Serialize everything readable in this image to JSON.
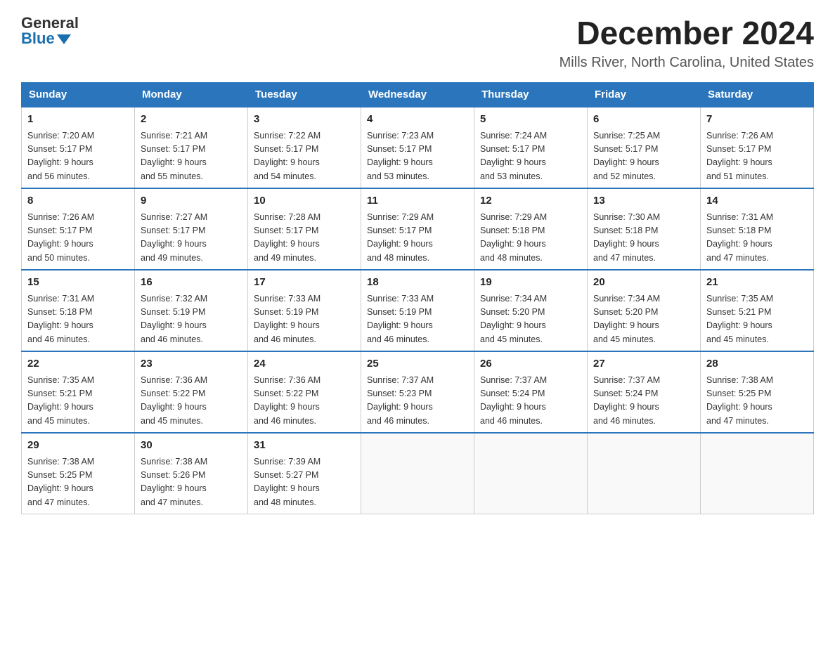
{
  "header": {
    "logo_general": "General",
    "logo_blue": "Blue",
    "title": "December 2024",
    "subtitle": "Mills River, North Carolina, United States"
  },
  "calendar": {
    "days_of_week": [
      "Sunday",
      "Monday",
      "Tuesday",
      "Wednesday",
      "Thursday",
      "Friday",
      "Saturday"
    ],
    "weeks": [
      [
        {
          "day": "1",
          "info": "Sunrise: 7:20 AM\nSunset: 5:17 PM\nDaylight: 9 hours\nand 56 minutes."
        },
        {
          "day": "2",
          "info": "Sunrise: 7:21 AM\nSunset: 5:17 PM\nDaylight: 9 hours\nand 55 minutes."
        },
        {
          "day": "3",
          "info": "Sunrise: 7:22 AM\nSunset: 5:17 PM\nDaylight: 9 hours\nand 54 minutes."
        },
        {
          "day": "4",
          "info": "Sunrise: 7:23 AM\nSunset: 5:17 PM\nDaylight: 9 hours\nand 53 minutes."
        },
        {
          "day": "5",
          "info": "Sunrise: 7:24 AM\nSunset: 5:17 PM\nDaylight: 9 hours\nand 53 minutes."
        },
        {
          "day": "6",
          "info": "Sunrise: 7:25 AM\nSunset: 5:17 PM\nDaylight: 9 hours\nand 52 minutes."
        },
        {
          "day": "7",
          "info": "Sunrise: 7:26 AM\nSunset: 5:17 PM\nDaylight: 9 hours\nand 51 minutes."
        }
      ],
      [
        {
          "day": "8",
          "info": "Sunrise: 7:26 AM\nSunset: 5:17 PM\nDaylight: 9 hours\nand 50 minutes."
        },
        {
          "day": "9",
          "info": "Sunrise: 7:27 AM\nSunset: 5:17 PM\nDaylight: 9 hours\nand 49 minutes."
        },
        {
          "day": "10",
          "info": "Sunrise: 7:28 AM\nSunset: 5:17 PM\nDaylight: 9 hours\nand 49 minutes."
        },
        {
          "day": "11",
          "info": "Sunrise: 7:29 AM\nSunset: 5:17 PM\nDaylight: 9 hours\nand 48 minutes."
        },
        {
          "day": "12",
          "info": "Sunrise: 7:29 AM\nSunset: 5:18 PM\nDaylight: 9 hours\nand 48 minutes."
        },
        {
          "day": "13",
          "info": "Sunrise: 7:30 AM\nSunset: 5:18 PM\nDaylight: 9 hours\nand 47 minutes."
        },
        {
          "day": "14",
          "info": "Sunrise: 7:31 AM\nSunset: 5:18 PM\nDaylight: 9 hours\nand 47 minutes."
        }
      ],
      [
        {
          "day": "15",
          "info": "Sunrise: 7:31 AM\nSunset: 5:18 PM\nDaylight: 9 hours\nand 46 minutes."
        },
        {
          "day": "16",
          "info": "Sunrise: 7:32 AM\nSunset: 5:19 PM\nDaylight: 9 hours\nand 46 minutes."
        },
        {
          "day": "17",
          "info": "Sunrise: 7:33 AM\nSunset: 5:19 PM\nDaylight: 9 hours\nand 46 minutes."
        },
        {
          "day": "18",
          "info": "Sunrise: 7:33 AM\nSunset: 5:19 PM\nDaylight: 9 hours\nand 46 minutes."
        },
        {
          "day": "19",
          "info": "Sunrise: 7:34 AM\nSunset: 5:20 PM\nDaylight: 9 hours\nand 45 minutes."
        },
        {
          "day": "20",
          "info": "Sunrise: 7:34 AM\nSunset: 5:20 PM\nDaylight: 9 hours\nand 45 minutes."
        },
        {
          "day": "21",
          "info": "Sunrise: 7:35 AM\nSunset: 5:21 PM\nDaylight: 9 hours\nand 45 minutes."
        }
      ],
      [
        {
          "day": "22",
          "info": "Sunrise: 7:35 AM\nSunset: 5:21 PM\nDaylight: 9 hours\nand 45 minutes."
        },
        {
          "day": "23",
          "info": "Sunrise: 7:36 AM\nSunset: 5:22 PM\nDaylight: 9 hours\nand 45 minutes."
        },
        {
          "day": "24",
          "info": "Sunrise: 7:36 AM\nSunset: 5:22 PM\nDaylight: 9 hours\nand 46 minutes."
        },
        {
          "day": "25",
          "info": "Sunrise: 7:37 AM\nSunset: 5:23 PM\nDaylight: 9 hours\nand 46 minutes."
        },
        {
          "day": "26",
          "info": "Sunrise: 7:37 AM\nSunset: 5:24 PM\nDaylight: 9 hours\nand 46 minutes."
        },
        {
          "day": "27",
          "info": "Sunrise: 7:37 AM\nSunset: 5:24 PM\nDaylight: 9 hours\nand 46 minutes."
        },
        {
          "day": "28",
          "info": "Sunrise: 7:38 AM\nSunset: 5:25 PM\nDaylight: 9 hours\nand 47 minutes."
        }
      ],
      [
        {
          "day": "29",
          "info": "Sunrise: 7:38 AM\nSunset: 5:25 PM\nDaylight: 9 hours\nand 47 minutes."
        },
        {
          "day": "30",
          "info": "Sunrise: 7:38 AM\nSunset: 5:26 PM\nDaylight: 9 hours\nand 47 minutes."
        },
        {
          "day": "31",
          "info": "Sunrise: 7:39 AM\nSunset: 5:27 PM\nDaylight: 9 hours\nand 48 minutes."
        },
        {
          "day": "",
          "info": ""
        },
        {
          "day": "",
          "info": ""
        },
        {
          "day": "",
          "info": ""
        },
        {
          "day": "",
          "info": ""
        }
      ]
    ]
  }
}
